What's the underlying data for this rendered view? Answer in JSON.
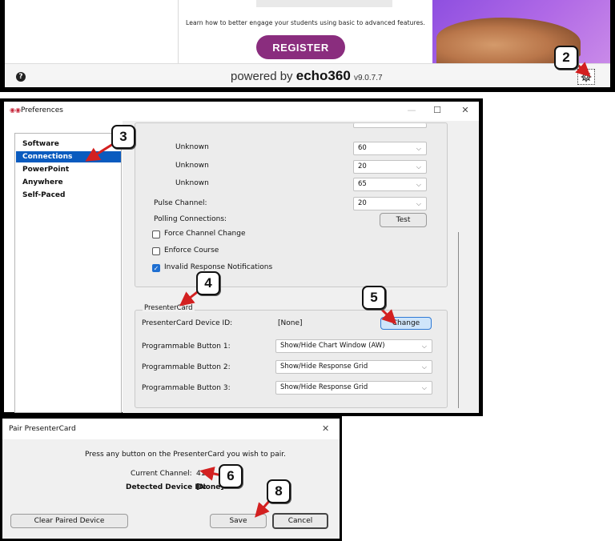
{
  "banner": {
    "subtitle": "Learn how to better engage your students using basic to advanced features.",
    "register_label": "REGISTER"
  },
  "footer": {
    "help_glyph": "?",
    "powered_prefix": "powered by",
    "brand": "echo360",
    "version": "v9.0.7.7"
  },
  "preferences": {
    "title": "Preferences",
    "nav": [
      "Software",
      "Connections",
      "PowerPoint",
      "Anywhere",
      "Self-Paced"
    ],
    "selected_nav": "Connections",
    "connections": {
      "rows": [
        {
          "label": "Unknown",
          "value": "60"
        },
        {
          "label": "Unknown",
          "value": "20"
        },
        {
          "label": "Unknown",
          "value": "65"
        }
      ],
      "pulse_channel_label": "Pulse Channel:",
      "pulse_channel_value": "20",
      "polling_label": "Polling Connections:",
      "test_label": "Test",
      "force_channel_label": "Force Channel Change",
      "enforce_course_label": "Enforce Course",
      "invalid_response_label": "Invalid Response Notifications",
      "force_channel_checked": false,
      "enforce_course_checked": false,
      "invalid_response_checked": true
    },
    "presentercard": {
      "legend": "PresenterCard",
      "device_id_label": "PresenterCard Device ID:",
      "device_id_value": "[None]",
      "change_label": "Change",
      "buttons": [
        {
          "label": "Programmable Button 1:",
          "value": "Show/Hide Chart Window (AW)"
        },
        {
          "label": "Programmable Button 2:",
          "value": "Show/Hide Response Grid"
        },
        {
          "label": "Programmable Button 3:",
          "value": "Show/Hide Response Grid"
        }
      ]
    }
  },
  "pair_dialog": {
    "title": "Pair PresenterCard",
    "instruction": "Press any button on the PresenterCard you wish to pair.",
    "current_channel_label": "Current Channel:",
    "current_channel_value": "41",
    "detected_label": "Detected Device ID:",
    "detected_value": "[None]",
    "clear_label": "Clear Paired Device",
    "save_label": "Save",
    "cancel_label": "Cancel"
  },
  "callouts": [
    "2",
    "3",
    "4",
    "5",
    "6",
    "8"
  ],
  "colors": {
    "accent_blue": "#0a5bbf",
    "register_purple": "#8a2d7e",
    "callout_arrow": "#d32020"
  }
}
